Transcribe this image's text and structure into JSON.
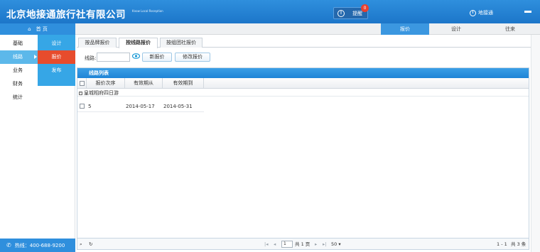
{
  "header": {
    "title": "北京地接通旅行社有限公司",
    "subtitle": "Know Local Reception",
    "remind_label": "提醒",
    "remind_count": "0",
    "user_name": "地接通"
  },
  "topbar": {
    "home_label": "首 页",
    "tabs": [
      {
        "label": "报价",
        "active": true
      },
      {
        "label": "设计",
        "active": false
      },
      {
        "label": "往来",
        "active": false
      }
    ]
  },
  "sidenav": {
    "items": [
      "基础",
      "线路",
      "业务",
      "财务",
      "统计"
    ],
    "active_item": "线路",
    "sub_items": [
      "设计",
      "报价",
      "发布"
    ],
    "active_sub_item": "报价"
  },
  "hotline": "热线：400-688-9200",
  "content_tabs": [
    {
      "label": "按品牌报价",
      "active": false
    },
    {
      "label": "按线路报价",
      "active": true
    },
    {
      "label": "按组团社报价",
      "active": false
    }
  ],
  "filter": {
    "route_label": "线路:",
    "route_value": "",
    "new_quote_button": "新报价",
    "edit_quote_button": "修改报价"
  },
  "panel": {
    "title": "线路列表",
    "columns": [
      "报价次序",
      "有效期从",
      "有效期到"
    ],
    "group_label": "皇城相府四日游",
    "rows": [
      {
        "order": "5",
        "from": "2014-05-17",
        "to": "2014-05-31"
      }
    ]
  },
  "pager": {
    "page_input": "1",
    "total_pages": "共 1 页",
    "page_size": "50",
    "range": "1 - 1",
    "total_records": "共 3 条"
  },
  "colors": {
    "header_blue": "#1c76c9",
    "active_red": "#e74c2d",
    "subnav_blue": "#36a6e6"
  }
}
